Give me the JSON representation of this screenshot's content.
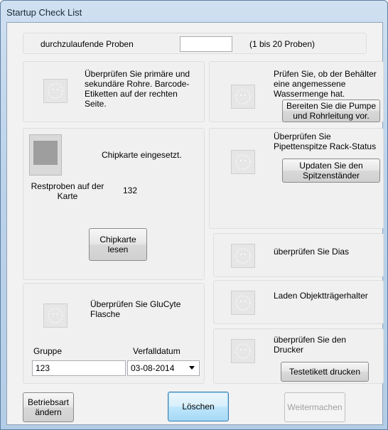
{
  "window": {
    "title": "Startup Check List"
  },
  "samples": {
    "label": "durchzulaufende Proben",
    "value": "",
    "hint": "(1 bis 20 Proben)"
  },
  "tubes": {
    "text": "Überprüfen Sie primäre und sekundäre Rohre. Barcode-Etiketten auf der rechten Seite."
  },
  "container": {
    "text": "Prüfen Sie, ob der Behälter eine angemessene Wassermenge hat.",
    "button": "Bereiten Sie die Pumpe und Rohrleitung vor."
  },
  "chipcard": {
    "status": "Chipkarte eingesetzt.",
    "remaining_label": "Restproben auf der Karte",
    "remaining_value": "132",
    "button": "Chipkarte lesen"
  },
  "pipette": {
    "text": "Überprüfen Sie Pipettenspitze Rack-Status",
    "button": "Updaten Sie den Spitzenständer"
  },
  "slides": {
    "text": "überprüfen Sie Dias"
  },
  "slide_holder": {
    "text": "Laden Objektträgerhalter"
  },
  "glucyte": {
    "text": "Überprüfen Sie GluCyte Flasche",
    "group_label": "Gruppe",
    "group_value": "123",
    "expiry_label": "Verfalldatum",
    "expiry_value": "03-08-2014"
  },
  "printer": {
    "text": "überprüfen Sie den Drucker",
    "button": "Testetikett drucken"
  },
  "footer": {
    "mode_button": "Betriebsart ändern",
    "clear_button": "Löschen",
    "continue_button": "Weitermachen"
  }
}
